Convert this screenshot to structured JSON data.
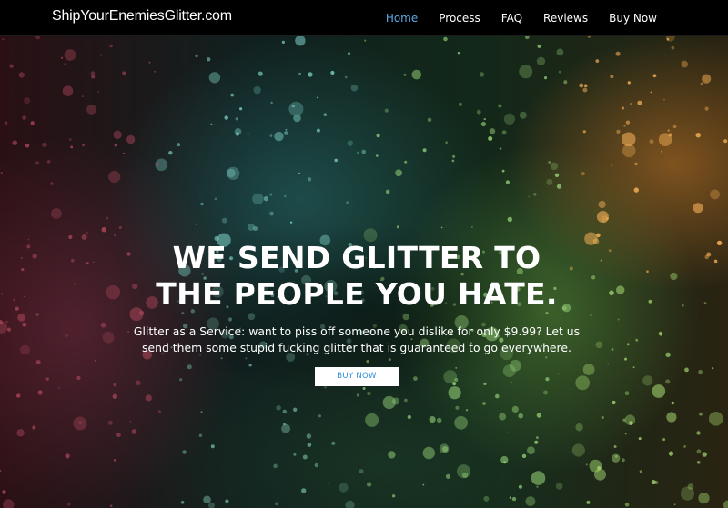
{
  "navbar": {
    "brand": "ShipYourEnemiesGlitter.com",
    "links": [
      {
        "label": "Home",
        "active": true
      },
      {
        "label": "Process",
        "active": false
      },
      {
        "label": "FAQ",
        "active": false
      },
      {
        "label": "Reviews",
        "active": false
      },
      {
        "label": "Buy Now",
        "active": false
      }
    ]
  },
  "hero": {
    "title_line1": "WE SEND GLITTER TO",
    "title_line2": "THE PEOPLE YOU HATE.",
    "text_line1": "Glitter as a Service: want to piss off someone you dislike for only $9.99? Let us",
    "text_line2": "send them some stupid fucking glitter that is guaranteed to go everywhere.",
    "button_label": "BUY NOW"
  },
  "colors": {
    "nav_background": "#000000",
    "active_link": "#5aa9e6",
    "button_text": "#2f8fd8"
  }
}
